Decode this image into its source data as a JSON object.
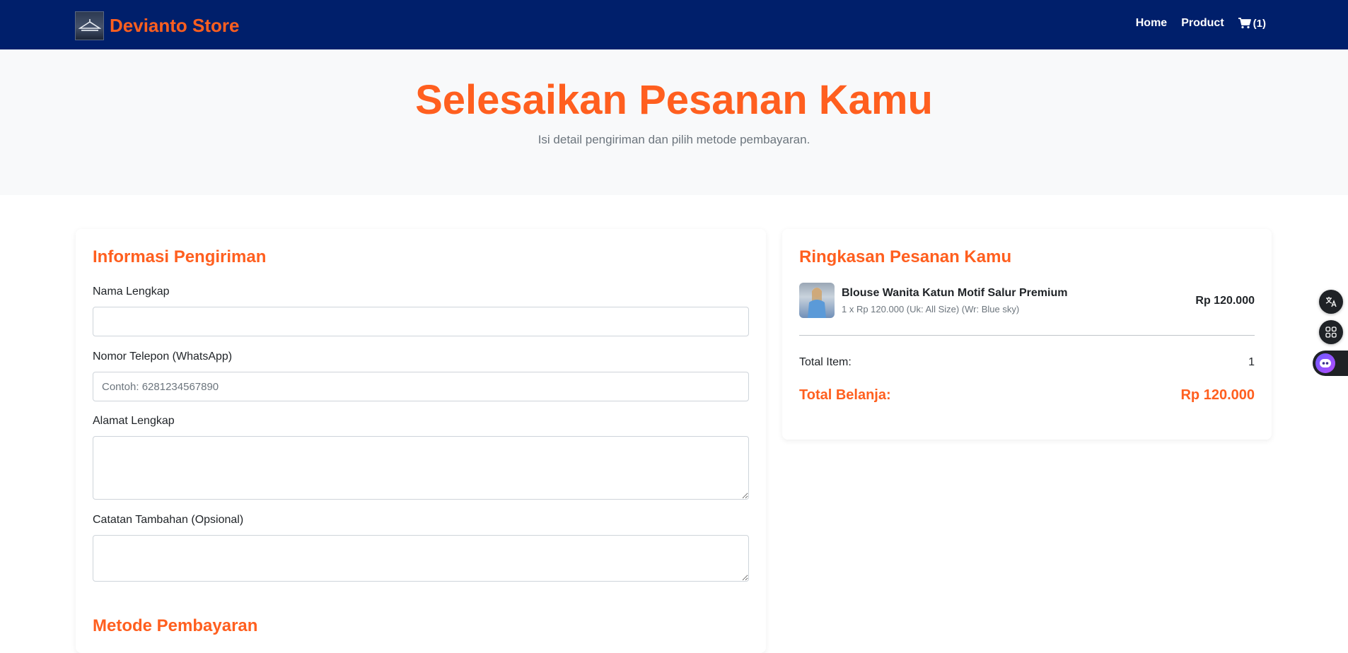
{
  "navbar": {
    "brand_name": "Devianto Store",
    "links": {
      "home": "Home",
      "product": "Product"
    },
    "cart_count": "(1)"
  },
  "hero": {
    "title": "Selesaikan Pesanan Kamu",
    "subtitle": "Isi detail pengiriman dan pilih metode pembayaran."
  },
  "shipping": {
    "title": "Informasi Pengiriman",
    "name_label": "Nama Lengkap",
    "name_value": "",
    "phone_label": "Nomor Telepon (WhatsApp)",
    "phone_placeholder": "Contoh: 6281234567890",
    "address_label": "Alamat Lengkap",
    "address_value": "",
    "notes_label": "Catatan Tambahan (Opsional)",
    "notes_value": ""
  },
  "payment": {
    "title": "Metode Pembayaran"
  },
  "summary": {
    "title": "Ringkasan Pesanan Kamu",
    "item": {
      "name": "Blouse Wanita Katun Motif Salur Premium",
      "detail": "1 x Rp 120.000 (Uk: All Size) (Wr: Blue sky)",
      "price": "Rp 120.000"
    },
    "total_item_label": "Total Item:",
    "total_item_value": "1",
    "grand_total_label": "Total Belanja:",
    "grand_total_value": "Rp 120.000"
  },
  "colors": {
    "navbar": "#001f6b",
    "accent": "#ff5f1f",
    "hero_bg": "#f8f9fa"
  },
  "icons": [
    "cart-icon",
    "translate-icon",
    "apps-icon",
    "assistant-icon"
  ]
}
